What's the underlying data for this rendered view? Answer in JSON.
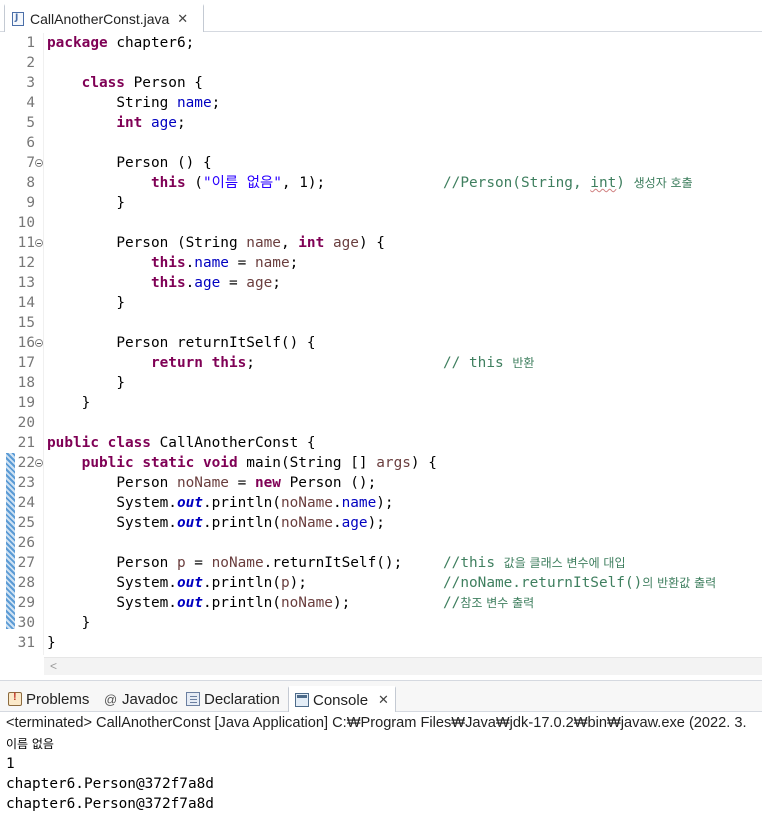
{
  "editor_tab": {
    "label": "CallAnotherConst.java",
    "close": "✕"
  },
  "code_lines": [
    "1",
    "2",
    "3",
    "4",
    "5",
    "6",
    "7",
    "8",
    "9",
    "10",
    "11",
    "12",
    "13",
    "14",
    "15",
    "16",
    "17",
    "18",
    "19",
    "20",
    "21",
    "22",
    "23",
    "24",
    "25",
    "26",
    "27",
    "28",
    "29",
    "30",
    "31"
  ],
  "code": {
    "l1_kw": "package",
    "l1_rest": " chapter6;",
    "l3_kw": "class",
    "l3_rest": " Person {",
    "l4_type": "String ",
    "l4_fld": "name",
    "l4_end": ";",
    "l5_kw": "int",
    "l5_fld": " age",
    "l5_end": ";",
    "l7": "Person () {",
    "l8_kw": "this",
    "l8_a": " (",
    "l8_str": "\"이름 없음\"",
    "l8_b": ", 1);",
    "l8_cm1": "//Person(String, ",
    "l8_cm2": "int",
    "l8_cm3": ") ",
    "l8_cm4": "생성자 호출",
    "l9": "}",
    "l11_a": "Person (String ",
    "l11_v1": "name",
    "l11_b": ", ",
    "l11_kw": "int",
    "l11_c": " ",
    "l11_v2": "age",
    "l11_d": ") {",
    "l12_kw": "this",
    "l12_a": ".",
    "l12_fld": "name",
    "l12_b": " = ",
    "l12_v": "name",
    "l12_c": ";",
    "l13_kw": "this",
    "l13_a": ".",
    "l13_fld": "age",
    "l13_b": " = ",
    "l13_v": "age",
    "l13_c": ";",
    "l14": "}",
    "l16": "Person returnItSelf() {",
    "l17_kw1": "return",
    "l17_sp": " ",
    "l17_kw2": "this",
    "l17_end": ";",
    "l17_cm1": "// this ",
    "l17_cm2": "반환",
    "l18": "}",
    "l19": "}",
    "l21_kw1": "public",
    "l21_sp": " ",
    "l21_kw2": "class",
    "l21_rest": " CallAnotherConst {",
    "l22_kw1": "public",
    "l22_kw2": "static",
    "l22_kw3": "void",
    "l22_a": " main(String [] ",
    "l22_v": "args",
    "l22_b": ") {",
    "l23_a": "Person ",
    "l23_v": "noName",
    "l23_b": " = ",
    "l23_kw": "new",
    "l23_c": " Person ();",
    "l24_a": "System.",
    "l24_out": "out",
    "l24_b": ".println(",
    "l24_v": "noName",
    "l24_c": ".",
    "l24_fld": "name",
    "l24_d": ");",
    "l25_a": "System.",
    "l25_out": "out",
    "l25_b": ".println(",
    "l25_v": "noName",
    "l25_c": ".",
    "l25_fld": "age",
    "l25_d": ");",
    "l27_a": "Person ",
    "l27_v1": "p",
    "l27_b": " = ",
    "l27_v2": "noName",
    "l27_c": ".returnItSelf();",
    "l27_cm1": "//this ",
    "l27_cm2": "값을 클래스 변수에 대입",
    "l28_a": "System.",
    "l28_out": "out",
    "l28_b": ".println(",
    "l28_v": "p",
    "l28_c": ");",
    "l28_cm1": "//noName.returnItSelf()",
    "l28_cm2": "의 반환값 출력",
    "l29_a": "System.",
    "l29_out": "out",
    "l29_b": ".println(",
    "l29_v": "noName",
    "l29_c": ");",
    "l29_cm1": "//",
    "l29_cm2": "참조 변수 출력",
    "l30": "}",
    "l31": "}"
  },
  "panel_tabs": {
    "problems": "Problems",
    "javadoc_symbol": "@",
    "javadoc": "Javadoc",
    "declaration": "Declaration",
    "console": "Console",
    "console_close": "✕"
  },
  "console": {
    "header": "<terminated> CallAnotherConst [Java Application] C:₩Program Files₩Java₩jdk-17.0.2₩bin₩javaw.exe  (2022. 3.",
    "output": [
      "이름 없음",
      "1",
      "chapter6.Person@372f7a8d",
      "chapter6.Person@372f7a8d"
    ]
  },
  "colors": {
    "keyword": "#7f0055",
    "field": "#0000c0",
    "string": "#2a00ff",
    "comment": "#3f7f5f",
    "local_variable": "#6a3e3e"
  }
}
